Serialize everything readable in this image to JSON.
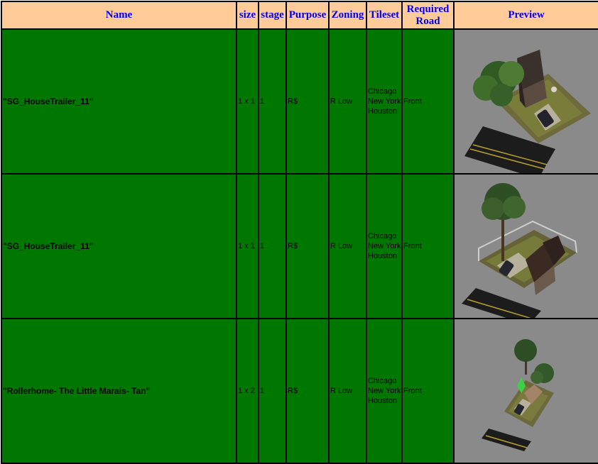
{
  "columns": {
    "name": "Name",
    "size": "size",
    "stage": "stage",
    "purpose": "Purpose",
    "zoning": "Zoning",
    "tileset": "Tileset",
    "required_road": "Required Road",
    "preview": "Preview"
  },
  "rows": [
    {
      "name": "\"SG_HouseTrailer_11\"",
      "size": "1 x 1",
      "stage": "1",
      "purpose": "R$",
      "zoning": "R Low",
      "tileset": "Chicago New York Houston",
      "required_road": "Front",
      "preview_image": "lot-preview-house-trailer-dark-roof-tree"
    },
    {
      "name": "\"SG_HouseTrailer_11\"",
      "size": "1 x 1",
      "stage": "1",
      "purpose": "R$",
      "zoning": "R Low",
      "tileset": "Chicago New York Houston",
      "required_road": "Front",
      "preview_image": "lot-preview-house-trailer-fenced-tall-tree"
    },
    {
      "name": "\"Rollerhome- The Little Marais- Tan\"",
      "size": "1 x 2",
      "stage": "1",
      "purpose": "R$",
      "zoning": "R Low",
      "tileset": "Chicago New York Houston",
      "required_road": "Front",
      "preview_image": "lot-preview-rollerhome-two-trees"
    }
  ],
  "colors": {
    "header_bg": "#ffcc99",
    "header_text": "#0000ee",
    "row_bg": "#007800",
    "preview_bg": "#8a8a8a"
  }
}
